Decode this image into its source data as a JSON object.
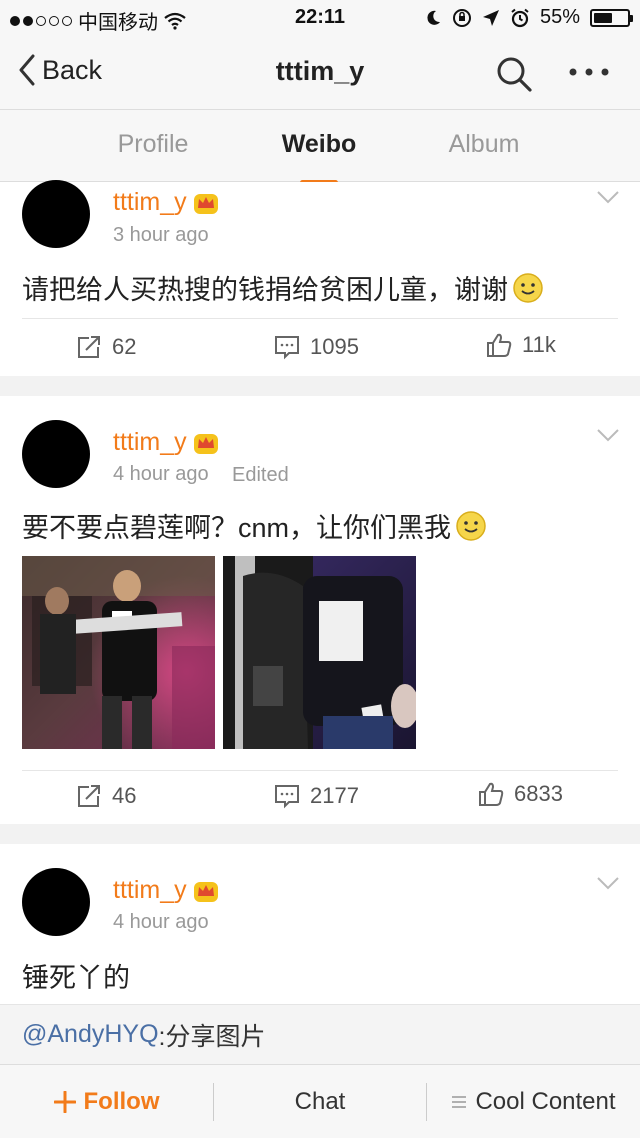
{
  "status_bar": {
    "carrier": "中国移动",
    "time": "22:11",
    "battery": "55%",
    "battery_level": 0.55,
    "signal_dots_filled": 2,
    "signal_dots_total": 5
  },
  "nav": {
    "back_label": "Back",
    "title": "tttim_y"
  },
  "tabs": [
    {
      "label": "Profile",
      "active": false
    },
    {
      "label": "Weibo",
      "active": true
    },
    {
      "label": "Album",
      "active": false
    }
  ],
  "posts": [
    {
      "username": "tttim_y",
      "time": "3 hour ago",
      "edited": "",
      "text": "请把给人买热搜的钱捐给贫困儿童，谢谢",
      "reposts": "62",
      "comments": "1095",
      "likes": "11k"
    },
    {
      "username": "tttim_y",
      "time": "4 hour ago",
      "edited": "Edited",
      "text": "要不要点碧莲啊？cnm，让你们黑我",
      "reposts": "46",
      "comments": "2177",
      "likes": "6833"
    },
    {
      "username": "tttim_y",
      "time": "4 hour ago",
      "edited": "",
      "text": "锤死丫的"
    }
  ],
  "share_bar": {
    "mention": "@AndyHYQ",
    "text": ":分享图片"
  },
  "bottom_bar": {
    "follow_label": "Follow",
    "chat_label": "Chat",
    "cool_content_label": "Cool Content"
  },
  "colors": {
    "accent": "#f27b1a",
    "mention": "#4a6fa5",
    "muted": "#999999"
  }
}
